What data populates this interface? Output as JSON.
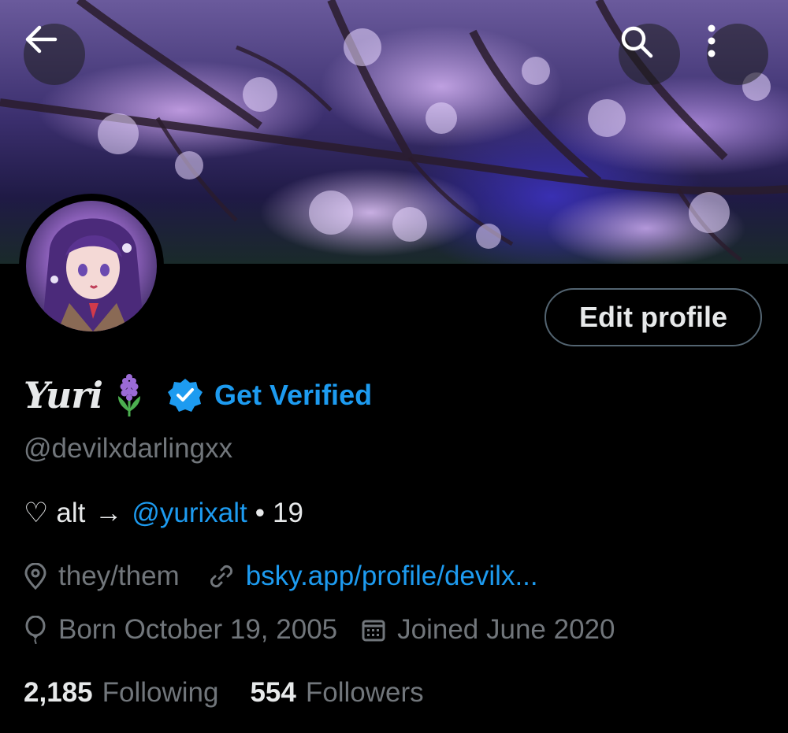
{
  "header": {
    "back_icon": "arrow-left-icon",
    "search_icon": "search-icon",
    "more_icon": "more-vertical-icon"
  },
  "profile": {
    "display_name": "Yuri",
    "name_emoji": "hyacinth-emoji",
    "get_verified_label": "Get Verified",
    "handle": "@devilxdarlingxx",
    "edit_profile_label": "Edit profile",
    "bio": {
      "heart": "♡",
      "alt_text": "alt",
      "arrow": "→",
      "mention": "@yurixalt",
      "separator": "•",
      "age": "19"
    },
    "pronouns": "they/them",
    "website": "bsky.app/profile/devilx...",
    "birthday": "Born October 19, 2005",
    "joined": "Joined June 2020",
    "following_count": "2,185",
    "following_label": "Following",
    "followers_count": "554",
    "followers_label": "Followers"
  },
  "colors": {
    "background": "#000000",
    "accent": "#1d9bf0",
    "secondary_text": "#71767b",
    "primary_text": "#e7e9ea"
  }
}
